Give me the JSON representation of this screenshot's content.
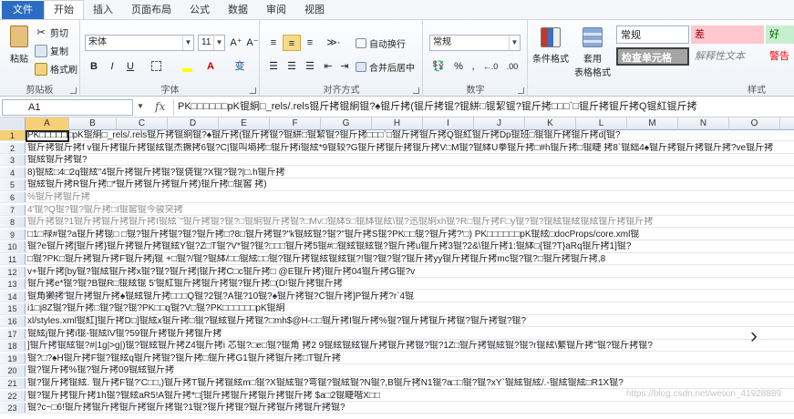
{
  "ribbon_tabs": [
    "文件",
    "开始",
    "插入",
    "页面布局",
    "公式",
    "数据",
    "审阅",
    "视图"
  ],
  "clipboard": {
    "paste": "粘贴",
    "cut": "剪切",
    "copy": "复制",
    "format_painter": "格式刷",
    "group_label": "剪贴板"
  },
  "font": {
    "name": "宋体",
    "size": "11",
    "grow": "A⁺",
    "shrink": "A⁻",
    "bold": "B",
    "italic": "I",
    "underline": "U",
    "pinyin": "变",
    "group_label": "字体"
  },
  "alignment": {
    "orientation": "≫·",
    "wrap_text": "自动换行",
    "merge_center": "合并后居中",
    "group_label": "对齐方式"
  },
  "number": {
    "format": "常规",
    "percent": "%",
    "comma": ",",
    "inc_decimal": "←.0",
    "dec_decimal": ".00",
    "group_label": "数字"
  },
  "styles": {
    "conditional": "条件格式",
    "table_format_1": "套用",
    "table_format_2": "表格格式",
    "normal": "常规",
    "bad": "差",
    "good": "好",
    "check_cell": "检查单元格",
    "explanatory": "解释性文本",
    "warning": "警告",
    "group_label": "样式"
  },
  "name_box": "A1",
  "fx_label": "fx",
  "formula_text": "PK□□□□□□pK锟絅□_rels/.rels锟斤拷锟絅锟?♠锟斤拷(锟斤拷锟?锟絣□锟絜锟?锟斤拷□□□`□锟斤拷锟斤拷Q锟紅锟斤拷",
  "columns": [
    "A",
    "B",
    "C",
    "D",
    "E",
    "F",
    "G",
    "H",
    "I",
    "J",
    "K",
    "L",
    "M",
    "N",
    "O"
  ],
  "rows": [
    {
      "n": "1",
      "text": "PK□□□□□□pK锟絅□_rels/.rels锟斤拷锟絅锟?♠锟斤拷(锟斤拷锟?锟絣□锟絜锟?锟斤拷□□□`□锟斤拷锟斤拷Q锟紅锟斤拷Dp锟班□锟锟斤拷锟斤拷d[锟?",
      "faded": false
    },
    {
      "n": "2",
      "text": "锟斤拷锟斤拷f v锟斤拷锟斤拷锟絃锟杰撅拷6锟?C|锟叫墒拷□锟斤拷i锟絃*9锟较?G锟斤拷锟斤拷锟斤拷V□M锟?锟絊U拳锟斤拷□#h锟斤拷□锟睫  拷8`锟絀4♠锟斤拷锟斤拷锟斤拷?ve锟斤拷",
      "faded": false
    },
    {
      "n": "3",
      "text": "锟絃锟斤拷锟?",
      "faded": false
    },
    {
      "n": "4",
      "text": "8)锟絃□4□2q锟絃\"4锟斤拷锟斤拷锟?锟侥锟?X锟?锟?|□.h锟斤拷",
      "faded": false
    },
    {
      "n": "5",
      "text": "锟絃锟斤拷R锟斤拷□*锟斤拷锟斤拷锟斤拷)锟斤拷□锟窖  拷)",
      "faded": false
    },
    {
      "n": "6",
      "text": "%锟斤拷锟斤拷",
      "faded": true
    },
    {
      "n": "7",
      "text": "4'锟?Q锟?锟?锟斤拷□I锟窖锟今骏突拷",
      "faded": true
    },
    {
      "n": "8",
      "text": "锟斤拷锟?1锟斤拷锟斤拷锟斤拷I锟絃`\"锟斤拷锟?锟?□锟絅锟斤拷锟?□Mv□锟絊5□锟絊锟絃\\锟?迅锟絅xh锟?R□锟斤拷F□y锟?锟?锟絃锟絃锟絃锟斤拷锟斤拷",
      "faded": true
    },
    {
      "n": "9",
      "text": "□1□禄#锟?a锟斤拷锟□ □锟?锟斤拷锟?锟?锟斤拷□?8□锟斤拷锟?\"k锟絃锟?锟?\"锟斤拷S锟?PK□□锟?锟斤拷?'□) PK□□□□□□pK锟絃□docProps/core.xml锟",
      "faded": false
    },
    {
      "n": "10",
      "text": "锟?e锟斤拷[锟斤拷}锟斤拷锟斤拷锟絃Y锟?Z□T锟?V*锟?锟?□□□锟斤拷5锟#□锟絃锟絃锟?锟斤拷u锟斤拷3锟?2&\\锟斤拷1:锟絊□{锟?T}aRq锟斤拷1]锟?",
      "faded": false
    },
    {
      "n": "11",
      "text": "□锟?PK□锟斤拷锟斤拷F锟斤拷j锟 +□锟?/锟?锟絊/□□锟絃□□锟?锟斤拷锟絃锟絃锟?!锟?锟?锟?锟斤拷yy锟斤拷锟斤拷mc锟?锟?□锟斤拷锟斤拷,8",
      "faded": false
    },
    {
      "n": "12",
      "text": "v+锟斤拷[by锟?锟絃锟斤拷x锟?锟?锟斤拷|锟斤拷C□c锟斤拷□ @E锟斤拷)锟斤拷04锟斤拷G锟?v",
      "faded": false
    },
    {
      "n": "13",
      "text": "锟斤拷e*锟?锟?B锟R□锟絃锟 5'锟紅锟斤拷锟斤拷锟?锟斤拷□(D!锟斤拷锟斤拷",
      "faded": false
    },
    {
      "n": "14",
      "text": "锟角獭拷'锟斤拷锟斤拷♠锟絃锟斤拷□□□Q锟?2锟?A锟?10锟?♠锟斤拷锟?C锟斤拷]P锟斤拷?r`4锟",
      "faded": false
    },
    {
      "n": "15",
      "text": "i1□j8Z锟?锟斤拷□锟?锟?锟?PK□□q锟?V□锟?PK□□□□□□pK锟絅",
      "faded": false
    },
    {
      "n": "16",
      "text": "xl/styles.xml锟紅]锟斤拷D□]锟絃x锟斤拷□锟?锟絃锟斤拷锟?□mh$@H-□□锟斤拷I锟斤拷%锟?锟斤拷锟斤拷锟?锟斤拷锟?锟?",
      "faded": false
    },
    {
      "n": "17",
      "text": "锟絃j锟斤拷i锟-锟絃lV锟?59锟斤拷锟斤拷锟斤拷",
      "faded": false
    },
    {
      "n": "18",
      "text": "]锟斤拷锟絃锟?#|1g|>g|)锟?锟絃锟斤拷Z4锟斤拷i 芯锟?□e□锟?锟角  拷2 9锟絃锟絃锟斤拷锟斤拷锟?锟?1Z□锟斤拷锟絃锟?锟?r锟絃\\蘩锟斤拷\"锟?锟斤拷锟?",
      "faded": false
    },
    {
      "n": "19",
      "text": "锟?□?♠H锟斤拷F锟?锟絃q锟斤拷锟?锟斤拷□锟斤拷G1锟斤拷锟斤拷□T锟斤拷",
      "faded": false
    },
    {
      "n": "20",
      "text": "锟?锟斤拷%锟?锟斤拷09锟絃锟斤拷",
      "faded": false
    },
    {
      "n": "21",
      "text": "锟?锟斤拷锟絃. 锟斤拷F锟?'C□□,)锟斤拷T锟斤拷锟絃m□锟?X锟絃锟?弯锟?锟絃锟?N锟?,B锟斤拷N1锟?a□□锟?锟?xY`锟絃锟絃/.-锟絃锟絃□R1X锟?",
      "faded": false
    },
    {
      "n": "22",
      "text": "锟?锟斤拷锟斤拷1h锟?锟絃aR5!A锟斤拷*□[锟斤拷锟斤拷锟斤拷锟斤拷 $a□2锟睫喈X□□",
      "faded": false
    },
    {
      "n": "23",
      "text": "锟?c~□6!锟斤拷锟斤拷锟斤拷锟斤拷锟?1锟?锟斤拷锟?锟斤拷锟斤拷锟斤拷锟?",
      "faded": false
    }
  ],
  "watermark": "https://blog.csdn.net/weixin_41928889"
}
